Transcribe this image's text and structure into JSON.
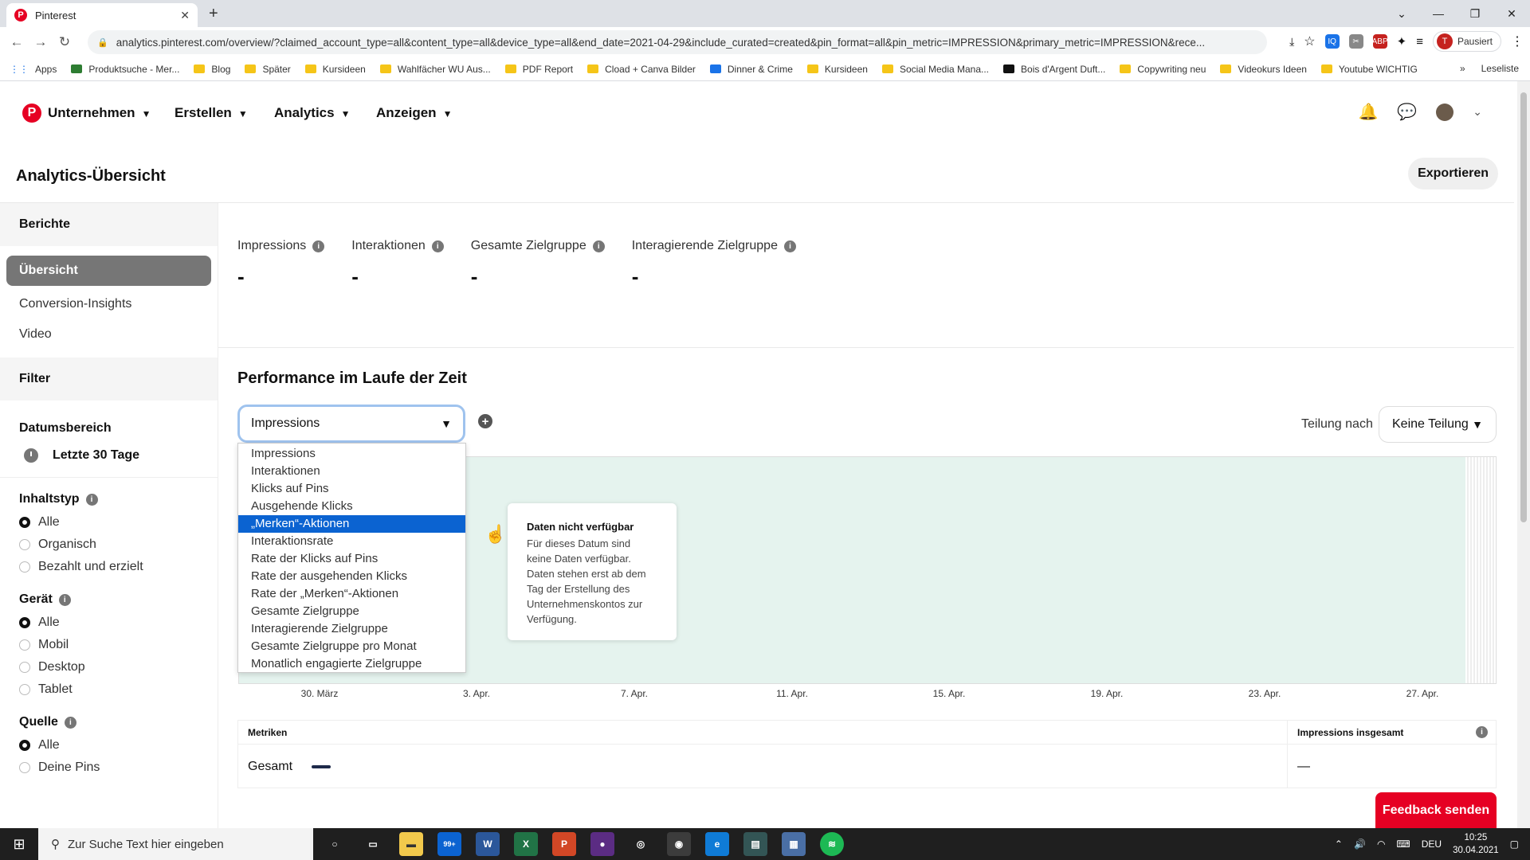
{
  "browser": {
    "tab_title": "Pinterest",
    "new_tab": "+",
    "url": "analytics.pinterest.com/overview/?claimed_account_type=all&content_type=all&device_type=all&end_date=2021-04-29&include_curated=created&pin_format=all&pin_metric=IMPRESSION&primary_metric=IMPRESSION&rece...",
    "profile_status": "Pausiert",
    "profile_initial": "T",
    "reading_list": "Leseliste",
    "bookmarks": [
      "Apps",
      "Produktsuche - Mer...",
      "Blog",
      "Später",
      "Kursideen",
      "Wahlfächer WU Aus...",
      "PDF Report",
      "Cload + Canva Bilder",
      "Dinner & Crime",
      "Kursideen",
      "Social Media Mana...",
      "Bois d'Argent Duft...",
      "Copywriting neu",
      "Videokurs Ideen",
      "Youtube WICHTIG"
    ],
    "more_bookmarks": "»"
  },
  "nav": {
    "items": [
      "Unternehmen",
      "Erstellen",
      "Analytics",
      "Anzeigen"
    ]
  },
  "header": {
    "title": "Analytics-Übersicht",
    "export": "Exportieren"
  },
  "sidebar": {
    "reports_title": "Berichte",
    "reports": [
      "Übersicht",
      "Conversion-Insights",
      "Video"
    ],
    "filter_title": "Filter",
    "date_label": "Datumsbereich",
    "date_value": "Letzte 30 Tage",
    "content_label": "Inhaltstyp",
    "content_options": [
      "Alle",
      "Organisch",
      "Bezahlt und erzielt"
    ],
    "device_label": "Gerät",
    "device_options": [
      "Alle",
      "Mobil",
      "Desktop",
      "Tablet"
    ],
    "source_label": "Quelle",
    "source_options": [
      "Alle",
      "Deine Pins"
    ]
  },
  "metrics": [
    {
      "label": "Impressions",
      "value": "-"
    },
    {
      "label": "Interaktionen",
      "value": "-"
    },
    {
      "label": "Gesamte Zielgruppe",
      "value": "-"
    },
    {
      "label": "Interagierende Zielgruppe",
      "value": "-"
    }
  ],
  "performance": {
    "title": "Performance im Laufe der Zeit",
    "selected_metric": "Impressions",
    "split_label": "Teilung nach",
    "split_value": "Keine Teilung",
    "dropdown_options": [
      "Impressions",
      "Interaktionen",
      "Klicks auf Pins",
      "Ausgehende Klicks",
      "„Merken“-Aktionen",
      "Interaktionsrate",
      "Rate der Klicks auf Pins",
      "Rate der ausgehenden Klicks",
      "Rate der „Merken“-Aktionen",
      "Gesamte Zielgruppe",
      "Interagierende Zielgruppe",
      "Gesamte Zielgruppe pro Monat",
      "Monatlich engagierte Zielgruppe"
    ],
    "highlighted_option_index": 4,
    "tooltip_title": "Daten nicht verfügbar",
    "tooltip_text": "Für dieses Datum sind keine Daten verfügbar. Daten stehen erst ab dem Tag der Erstellung des Unternehmenskontos zur Verfügung.",
    "x_ticks": [
      "30. März",
      "3. Apr.",
      "7. Apr.",
      "11. Apr.",
      "15. Apr.",
      "19. Apr.",
      "23. Apr.",
      "27. Apr."
    ]
  },
  "table": {
    "col1_header": "Metriken",
    "col2_header": "Impressions insgesamt",
    "row_label": "Gesamt",
    "row_value": "—"
  },
  "feedback": "Feedback senden",
  "taskbar": {
    "search_placeholder": "Zur Suche Text hier eingeben",
    "mail_badge": "99+",
    "language": "DEU",
    "time": "10:25",
    "date": "30.04.2021"
  },
  "colors": {
    "brand": "#e60023",
    "highlight": "#0b63d1",
    "chart_bg": "#e5f3ee"
  }
}
